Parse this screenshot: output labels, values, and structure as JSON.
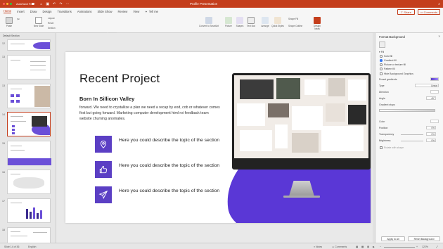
{
  "titlebar": {
    "autosave_label": "AutoSave",
    "autosave_state": "OFF",
    "document_title": "Profile Presentation",
    "traffic_lights": [
      "#ff5f57",
      "#febc2e",
      "#28c840"
    ]
  },
  "ribbon": {
    "tabs": [
      "Home",
      "Insert",
      "Draw",
      "Design",
      "Transitions",
      "Animations",
      "Slide Show",
      "Review",
      "View"
    ],
    "active_tab": "Home",
    "tell_me": "Tell me",
    "share": "Share",
    "comments": "Comments",
    "font_name": "Lato Regular (Body)",
    "tools": {
      "paste": "Paste",
      "new_slide": "New Slide",
      "layout": "Layout",
      "reset": "Reset",
      "section": "Section",
      "convert": "Convert to SmartArt",
      "picture": "Picture",
      "shapes": "Shapes",
      "textbox": "Text Box",
      "arrange": "Arrange",
      "quick_styles": "Quick Styles",
      "shape_fill": "Shape Fill",
      "shape_outline": "Shape Outline",
      "design_ideas": "Design Ideas"
    }
  },
  "slides_panel": {
    "section_header": "Default Section",
    "numbers": [
      "12",
      "13",
      "14",
      "15",
      "16",
      "17",
      "18"
    ],
    "selected": "14"
  },
  "slide": {
    "title": "Recent Project",
    "subtitle": "Born In Sillicon Valley",
    "body": "forward. We need to crystallize a plan we need a recap by eod, cob or whatever comes first but going forward. Marketing computer development html roi feedback team website churning anomalies.",
    "features": [
      {
        "icon": "map-pin-icon",
        "text": "Here you could describe the topic of the section"
      },
      {
        "icon": "thumbs-up-icon",
        "text": "Here you could describe the topic of the section"
      },
      {
        "icon": "paper-plane-icon",
        "text": "Here you could describe the topic of the section"
      }
    ],
    "accent_color": "#5b3fc4"
  },
  "format_panel": {
    "title": "Format Background",
    "fill_section": "Fill",
    "fill_options": [
      "Solid fill",
      "Gradient fill",
      "Picture or texture fill",
      "Pattern fill"
    ],
    "fill_selected": "Gradient fill",
    "hide_bg": "Hide Background Graphics",
    "preset_gradients": "Preset gradients",
    "type_label": "Type",
    "type_value": "Linear",
    "direction_label": "Direction",
    "angle_label": "Angle",
    "angle_value": "45°",
    "stops_label": "Gradient stops",
    "color_label": "Color",
    "position_label": "Position",
    "position_value": "0%",
    "transparency_label": "Transparency",
    "transparency_value": "0%",
    "brightness_label": "Brightness",
    "brightness_value": "0%",
    "rotate_label": "Rotate with shape",
    "apply_all": "Apply to All",
    "reset_bg": "Reset Background"
  },
  "statusbar": {
    "slide_count": "Slide 14 of 36",
    "language": "English",
    "notes": "Notes",
    "comments": "Comments",
    "zoom": "122%"
  }
}
